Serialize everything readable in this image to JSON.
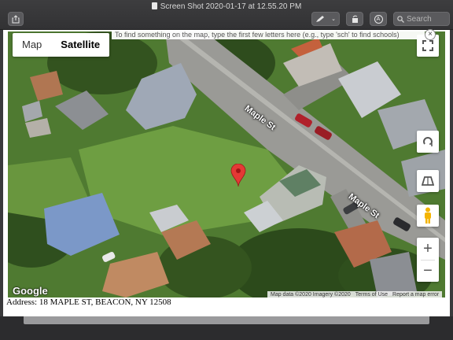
{
  "window": {
    "title": "Screen Shot 2020-01-17 at 12.55.20 PM",
    "search_placeholder": "Search",
    "toolbar_icons": [
      "share-icon",
      "markup-pen-icon",
      "rotate-icon",
      "annotate-icon",
      "search-icon"
    ]
  },
  "map": {
    "type_tabs": [
      {
        "label": "Map",
        "active": false
      },
      {
        "label": "Satellite",
        "active": true
      }
    ],
    "hint": "To find something on the map, type the first few letters here (e.g., type 'sch' to find schools)",
    "hint_close": "×",
    "street_labels": [
      "Maple St",
      "Maple St"
    ],
    "zoom_in": "+",
    "zoom_out": "−",
    "logo": "Google",
    "attribution": {
      "data": "Map data ©2020 Imagery ©2020",
      "terms": "Terms of Use",
      "report": "Report a map error"
    },
    "controls": [
      "fullscreen-icon",
      "rotate-map-icon",
      "tilt-icon",
      "pegman-icon"
    ],
    "marker": "red-pin-icon"
  },
  "address": "Address: 18 MAPLE ST, BEACON, NY 12508",
  "colors": {
    "titlebar": "#3d3d3f",
    "grass": "#5f8f3c",
    "road": "#9a9a96",
    "pin": "#e53935"
  }
}
